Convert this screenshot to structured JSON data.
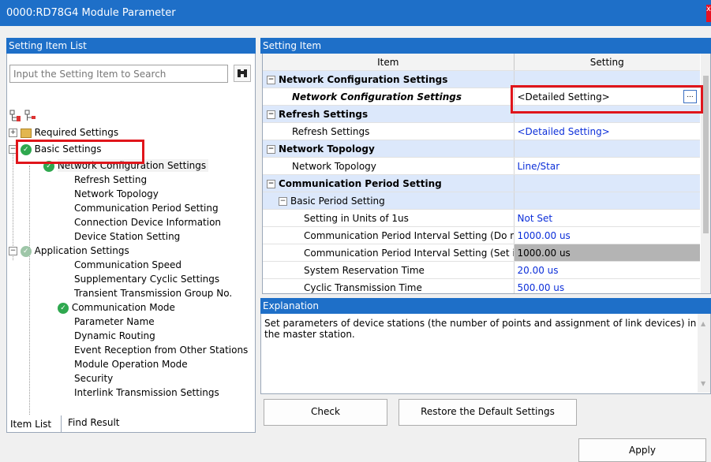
{
  "window": {
    "title": "0000:RD78G4 Module Parameter",
    "close_glyph": "x"
  },
  "left": {
    "header": "Setting Item List",
    "search_placeholder": "Input the Setting Item to Search",
    "tree": {
      "required": "Required Settings",
      "basic": "Basic Settings",
      "basic_children": [
        "Network Configuration Settings",
        "Refresh Setting",
        "Network Topology",
        "Communication Period Setting",
        "Connection Device Information",
        "Device Station Setting"
      ],
      "application": "Application Settings",
      "application_children": [
        "Communication Speed",
        "Supplementary Cyclic Settings",
        "Transient Transmission Group No.",
        "Communication Mode",
        "Parameter Name",
        "Dynamic Routing",
        "Event Reception from Other Stations",
        "Module Operation Mode",
        "Security",
        "Interlink Transmission Settings"
      ]
    },
    "tabs": [
      "Item List",
      "Find Result"
    ]
  },
  "right": {
    "header": "Setting Item",
    "columns": [
      "Item",
      "Setting"
    ],
    "rows": [
      {
        "kind": "section",
        "item": "Network Configuration Settings",
        "value": ""
      },
      {
        "kind": "child-bold",
        "item": "Network Configuration Settings",
        "value": "<Detailed Setting>"
      },
      {
        "kind": "section",
        "item": "Refresh Settings",
        "value": ""
      },
      {
        "kind": "child",
        "item": "Refresh Settings",
        "value": "<Detailed Setting>"
      },
      {
        "kind": "section",
        "item": "Network Topology",
        "value": ""
      },
      {
        "kind": "child",
        "item": "Network Topology",
        "value": "Line/Star"
      },
      {
        "kind": "section",
        "item": "Communication Period Setting",
        "value": ""
      },
      {
        "kind": "subsection",
        "item": "Basic Period Setting",
        "value": ""
      },
      {
        "kind": "leaf",
        "item": "Setting in Units of 1us",
        "value": "Not Set"
      },
      {
        "kind": "leaf",
        "item": "Communication Period Interval Setting (Do no",
        "value": "1000.00 us"
      },
      {
        "kind": "leaf-grey",
        "item": "Communication Period Interval Setting (Set it",
        "value": "1000.00 us"
      },
      {
        "kind": "leaf",
        "item": "System Reservation Time",
        "value": "20.00 us"
      },
      {
        "kind": "leaf",
        "item": "Cyclic Transmission Time",
        "value": "500.00 us"
      }
    ],
    "ellipsis": "...",
    "explanation_header": "Explanation",
    "explanation_text": "Set parameters of device stations (the number of points and assignment of link devices) in the master station.",
    "check_button": "Check",
    "restore_button": "Restore the Default Settings"
  },
  "apply_button": "Apply",
  "colors": {
    "title_blue": "#1e6fc8",
    "highlight_red": "#e0151b",
    "value_blue": "#0c2fd9"
  }
}
